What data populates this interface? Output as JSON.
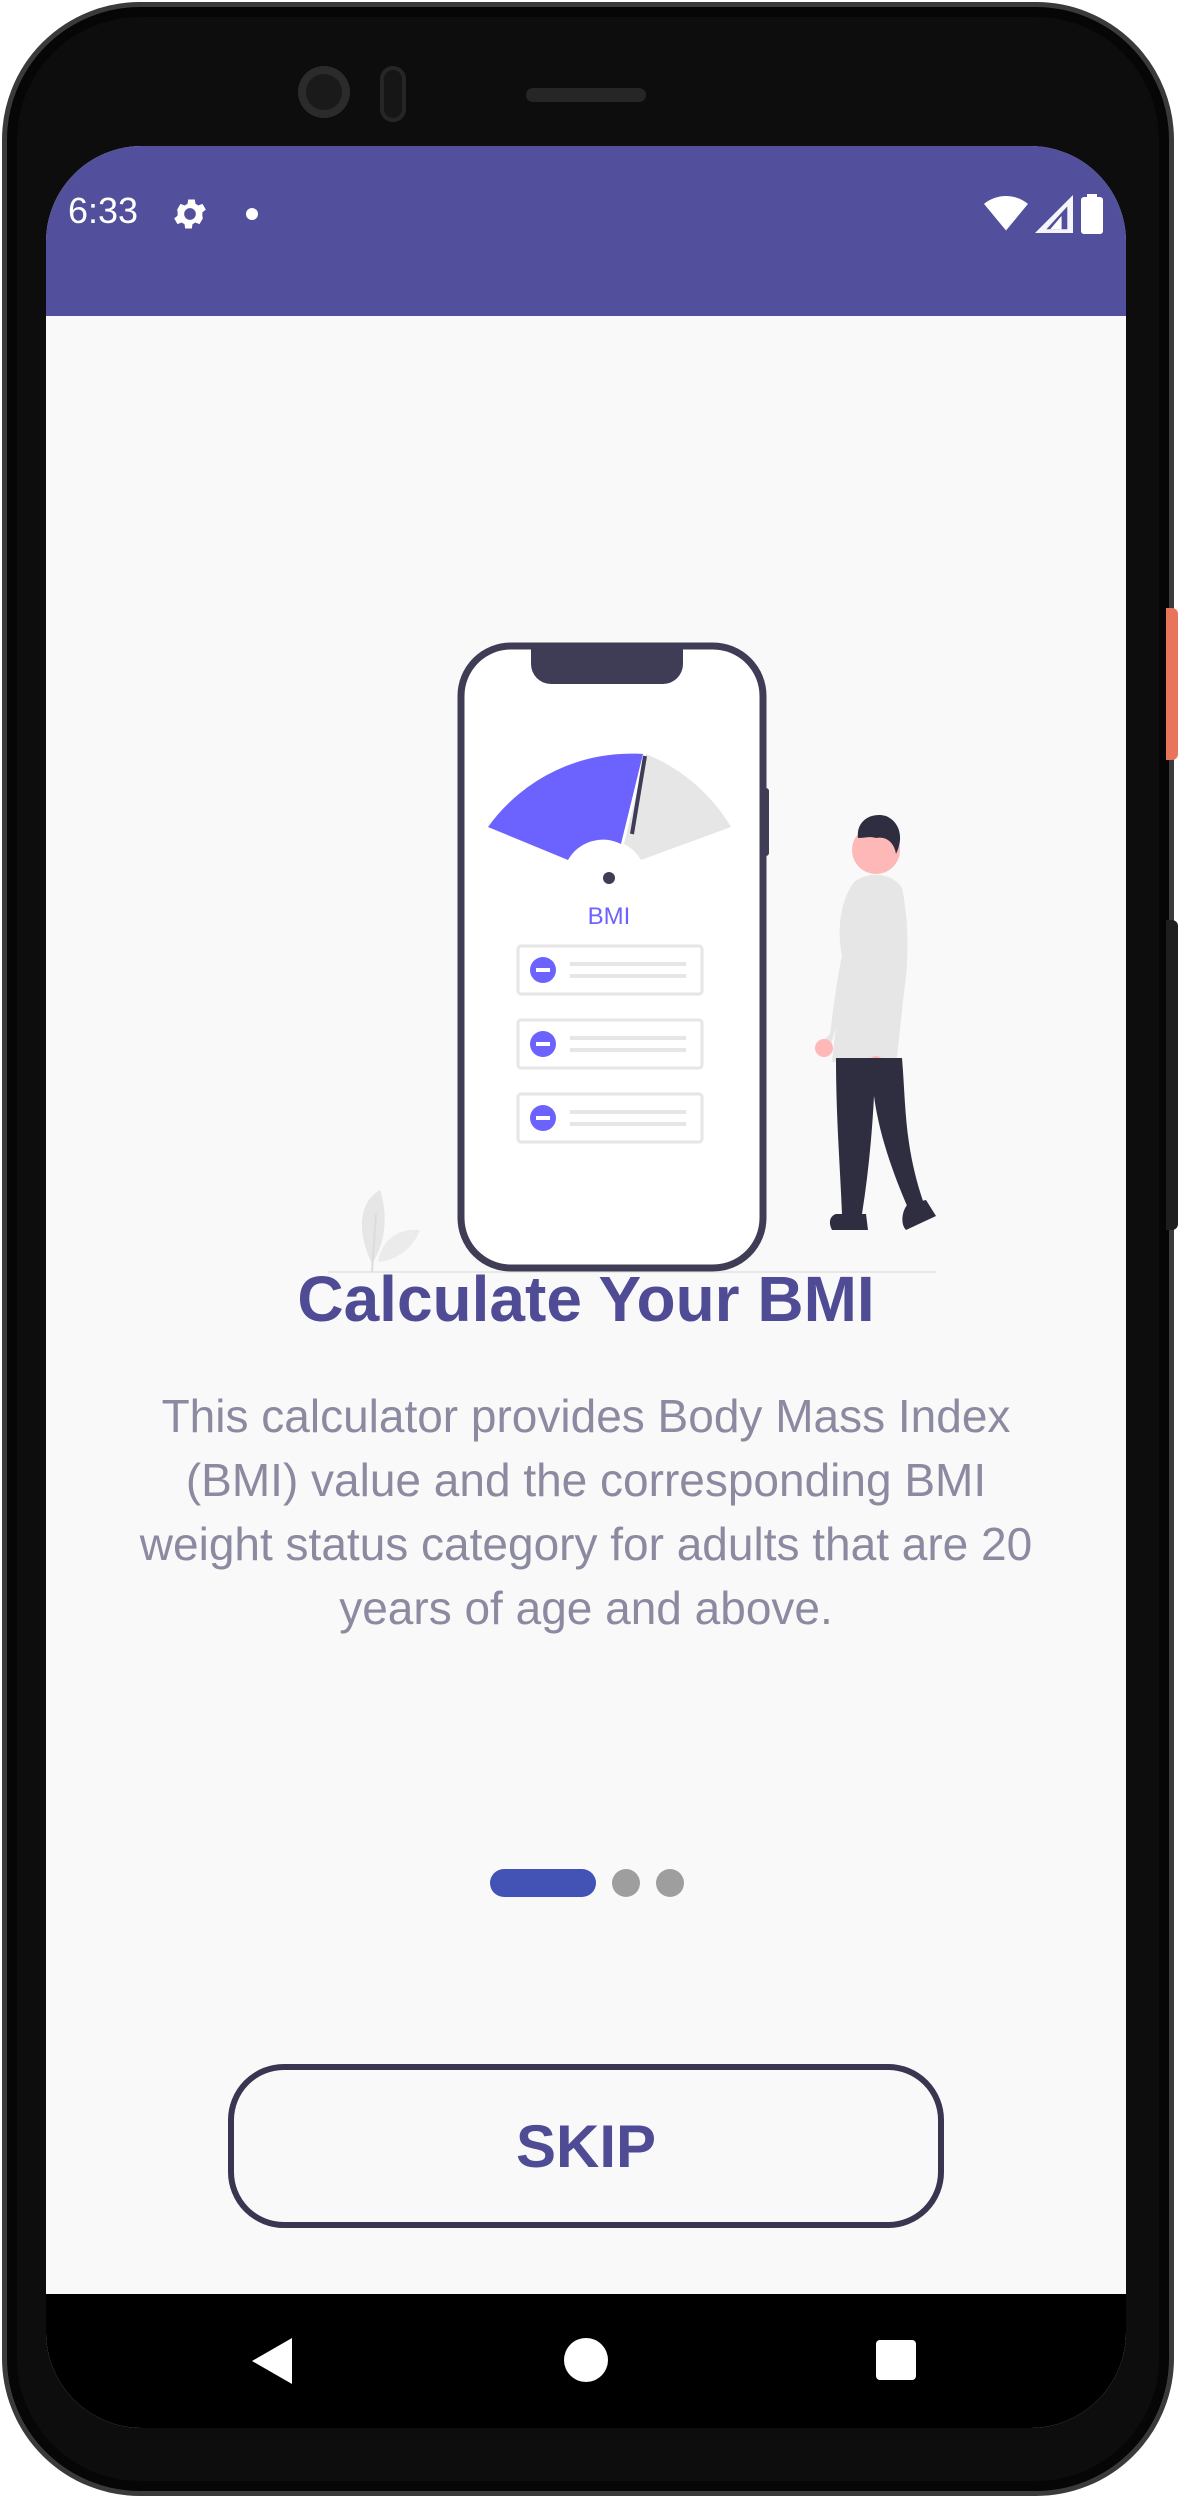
{
  "status_bar": {
    "time": "6:33",
    "background": "#524f9c"
  },
  "onboarding": {
    "illustration": {
      "gauge_label": "BMI"
    },
    "title": "Calculate Your BMI",
    "description": "This calculator provides Body Mass Index (BMI) value and the corresponding BMI weight status category for adults that are 20 years of age and above.",
    "page_indicator": {
      "current_page": 1,
      "total_pages": 3,
      "active_color": "#4352b5",
      "inactive_color": "#9e9e9e"
    },
    "skip_label": "SKIP"
  },
  "colors": {
    "accent": "#4f4b94",
    "primary": "#524f9c",
    "illustration_purple": "#6c63ff"
  },
  "nav_bar": {
    "icons": [
      "back-icon",
      "home-icon",
      "recents-icon"
    ]
  }
}
